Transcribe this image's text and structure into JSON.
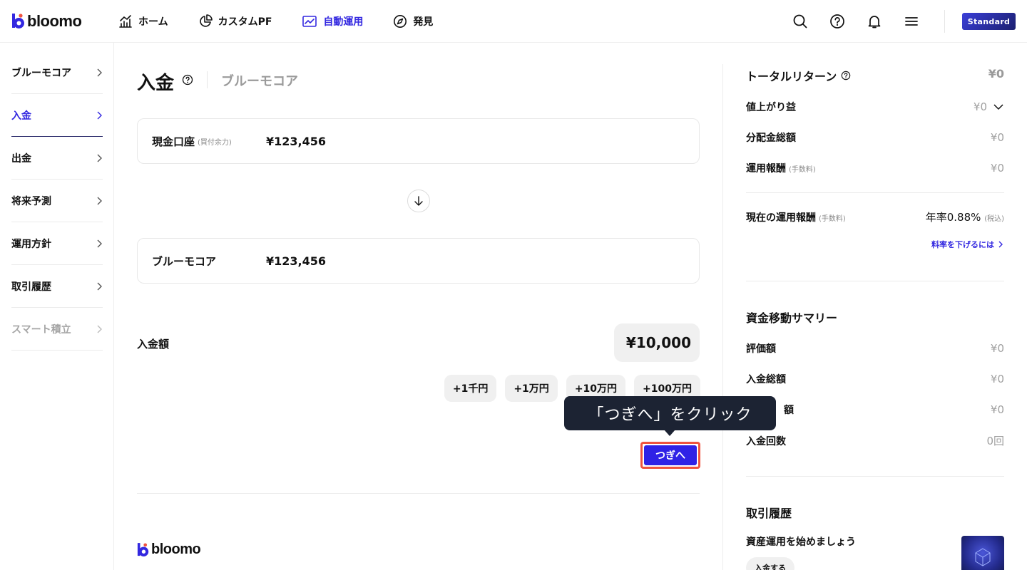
{
  "header": {
    "logo_text": "bloomo",
    "nav": [
      {
        "label": "ホーム",
        "icon": "chart-bars-icon"
      },
      {
        "label": "カスタムPF",
        "icon": "pie-chart-icon"
      },
      {
        "label": "自動運用",
        "icon": "line-chart-icon",
        "active": true
      },
      {
        "label": "発見",
        "icon": "compass-icon"
      }
    ],
    "icons": [
      "search-icon",
      "help-icon",
      "bell-icon",
      "menu-icon"
    ],
    "plan_badge": "Standard"
  },
  "sidebar": {
    "items": [
      {
        "label": "ブルーモコア",
        "state": "normal"
      },
      {
        "label": "入金",
        "state": "active"
      },
      {
        "label": "出金",
        "state": "normal"
      },
      {
        "label": "将来予測",
        "state": "normal"
      },
      {
        "label": "運用方針",
        "state": "normal"
      },
      {
        "label": "取引履歴",
        "state": "normal"
      },
      {
        "label": "スマート積立",
        "state": "disabled"
      }
    ]
  },
  "main": {
    "title": "入金",
    "subtitle": "ブルーモコア",
    "from_account": {
      "name": "現金口座",
      "note": "(買付余力)",
      "value": "¥123,456"
    },
    "to_account": {
      "name": "ブルーモコア",
      "value": "¥123,456"
    },
    "amount_label": "入金額",
    "amount_value": "¥10,000",
    "chips": [
      "+1千円",
      "+1万円",
      "+10万円",
      "+100万円"
    ],
    "next_label": "つぎへ",
    "tooltip": "「つぎへ」をクリック",
    "footer_logo": "bloomo"
  },
  "right_panel": {
    "total_return": {
      "title": "トータルリターン",
      "value": "¥0"
    },
    "rows": [
      {
        "label": "値上がり益",
        "value": "¥0"
      },
      {
        "label": "分配金総額",
        "value": "¥0"
      },
      {
        "label": "運用報酬",
        "note": "(手数料)",
        "value": "¥0"
      }
    ],
    "current_fee": {
      "label": "現在の運用報酬",
      "note": "(手数料)",
      "value": "年率0.88%",
      "tax": "(税込)"
    },
    "fee_link": "料率を下げるには",
    "summary": {
      "title": "資金移動サマリー",
      "rows": [
        {
          "label": "評価額",
          "value": "¥0"
        },
        {
          "label": "入金総額",
          "value": "¥0"
        },
        {
          "label": "額",
          "value": "¥0"
        },
        {
          "label": "入金回数",
          "value": "0回"
        }
      ]
    },
    "history": {
      "title": "取引履歴",
      "message": "資産運用を始めましょう",
      "button": "入金する"
    }
  },
  "colors": {
    "accent": "#3328e0",
    "button": "#2f22e6",
    "highlight": "#f0533f",
    "tooltip_bg": "#1c2333"
  }
}
